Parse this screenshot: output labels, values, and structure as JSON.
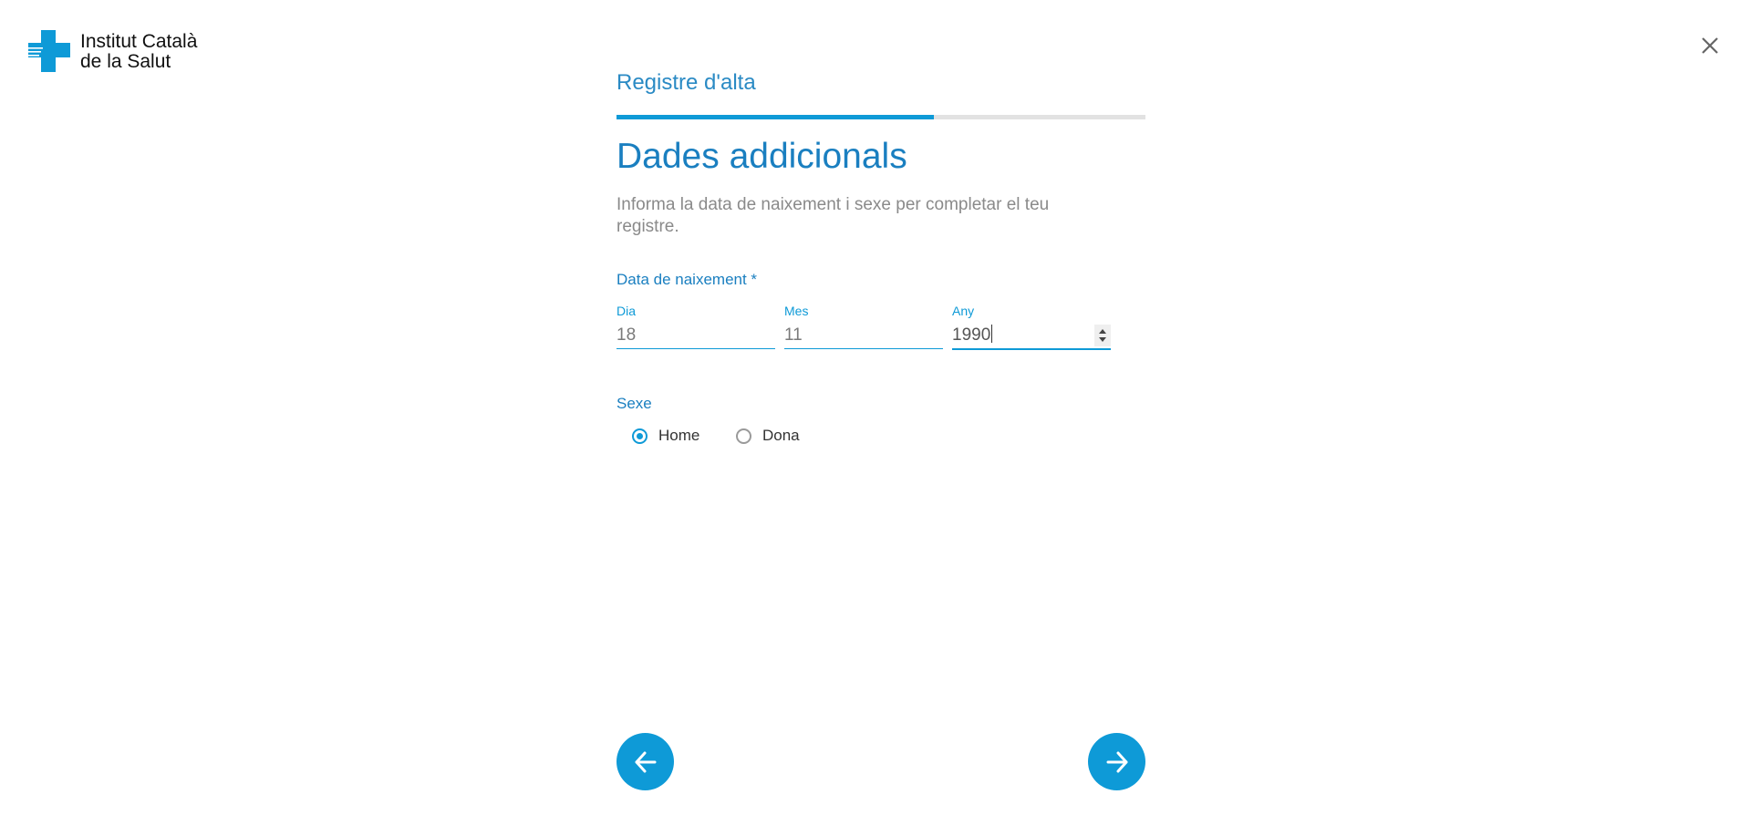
{
  "logo": {
    "line1": "Institut Català",
    "line2": "de la Salut",
    "brand_color": "#0e9ad7"
  },
  "header": {
    "close_icon": "close-icon"
  },
  "form": {
    "eyebrow": "Registre d'alta",
    "progress_fraction": 0.6,
    "title": "Dades addicionals",
    "description": "Informa la data de naixement i sexe per completar el teu registre.",
    "birthdate": {
      "label": "Data de naixement *",
      "day": {
        "label": "Dia",
        "value": "18"
      },
      "month": {
        "label": "Mes",
        "value": "11"
      },
      "year": {
        "label": "Any",
        "value": "1990"
      }
    },
    "sex": {
      "label": "Sexe",
      "options": [
        {
          "label": "Home",
          "checked": true
        },
        {
          "label": "Dona",
          "checked": false
        }
      ]
    }
  },
  "navigation": {
    "back_icon": "arrow-left-icon",
    "next_icon": "arrow-right-icon"
  },
  "colors": {
    "accent": "#0e9ad7",
    "heading": "#1a7fc0",
    "muted_text": "#8a8a8a"
  }
}
